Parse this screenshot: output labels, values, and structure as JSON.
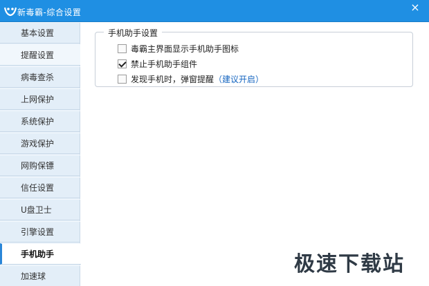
{
  "window": {
    "title": "新毒霸-综合设置"
  },
  "sidebar": {
    "items": [
      {
        "label": "基本设置"
      },
      {
        "label": "提醒设置"
      },
      {
        "label": "病毒查杀"
      },
      {
        "label": "上网保护"
      },
      {
        "label": "系统保护"
      },
      {
        "label": "游戏保护"
      },
      {
        "label": "网购保镖"
      },
      {
        "label": "信任设置"
      },
      {
        "label": "U盘卫士"
      },
      {
        "label": "引擎设置"
      },
      {
        "label": "手机助手"
      },
      {
        "label": "加速球"
      }
    ],
    "active_label": "手机助手"
  },
  "settings_group": {
    "title": "手机助手设置",
    "options": [
      {
        "label": "毒霸主界面显示手机助手图标",
        "checked": false
      },
      {
        "label": "禁止手机助手组件",
        "checked": true
      },
      {
        "label": "发现手机时，弹窗提醒",
        "link": "（建议开启）",
        "checked": false
      }
    ]
  },
  "watermark": "极速下载站",
  "icons": {
    "close": "×"
  },
  "colors": {
    "titlebar": "#1f8fe3",
    "sidebar": "#e3eef8",
    "link": "#1565c0"
  }
}
